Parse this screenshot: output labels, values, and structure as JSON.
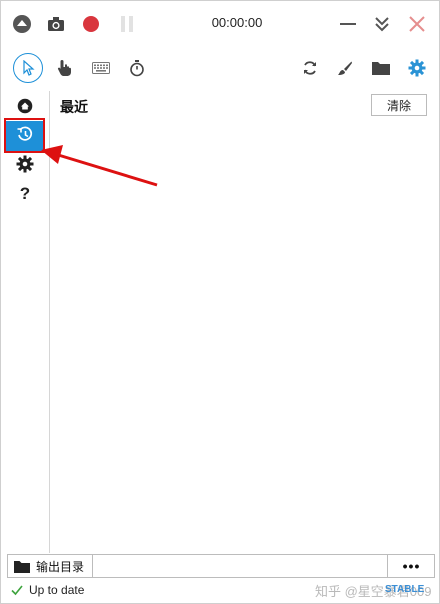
{
  "titlebar": {
    "timer": "00:00:00",
    "icons": [
      "chevron-up-circle-icon",
      "camera-icon",
      "record-icon",
      "pause-icon",
      "minimize-icon",
      "collapse-icon",
      "close-icon"
    ]
  },
  "toolbar": {
    "icons": [
      "cursor-icon",
      "hand-pointer-icon",
      "keyboard-icon",
      "stopwatch-icon",
      "refresh-icon",
      "brush-icon",
      "folder-icon",
      "gear-icon"
    ]
  },
  "sidebar": {
    "icons": [
      "home-icon",
      "history-icon",
      "settings-icon",
      "help-icon"
    ],
    "help_label": "?"
  },
  "main": {
    "title": "最近",
    "clear_label": "清除"
  },
  "output": {
    "label": "输出目录",
    "path": "",
    "more_label": "•••"
  },
  "status": {
    "text": "Up to date",
    "badge": "STABLE",
    "watermark": "知乎 @星空暴君009"
  },
  "colors": {
    "accent": "#1e90d8",
    "record": "#d9363e",
    "annotation": "#dd1111"
  }
}
